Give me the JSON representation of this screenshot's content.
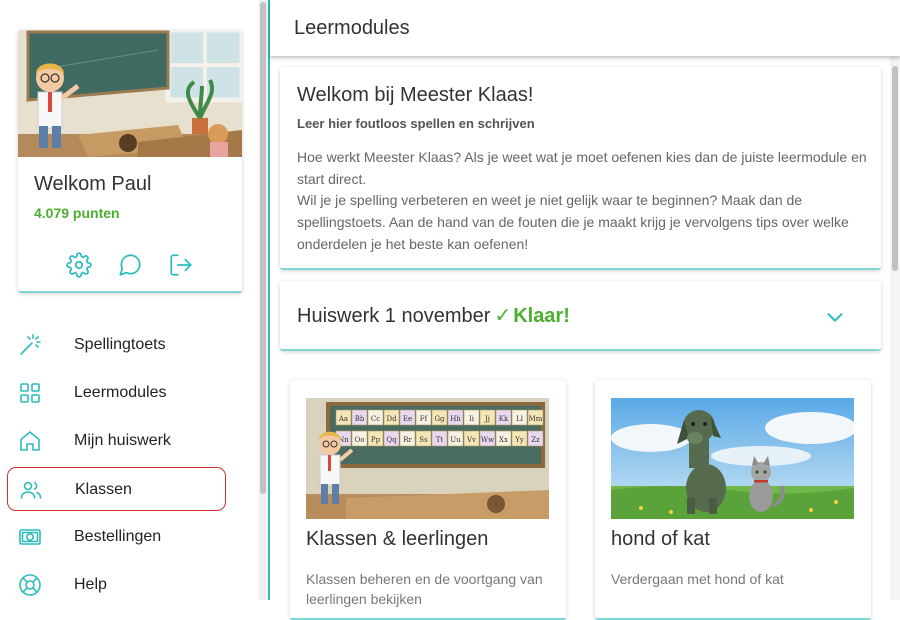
{
  "profile": {
    "greeting": "Welkom Paul",
    "points": "4.079 punten",
    "actions": [
      {
        "icon": "gear-icon"
      },
      {
        "icon": "chat-icon"
      },
      {
        "icon": "logout-icon"
      }
    ]
  },
  "nav": {
    "items": [
      {
        "label": "Spellingtoets",
        "icon": "magic-wand-icon",
        "active": false
      },
      {
        "label": "Leermodules",
        "icon": "grid-icon",
        "active": false
      },
      {
        "label": "Mijn huiswerk",
        "icon": "home-icon",
        "active": false
      },
      {
        "label": "Klassen",
        "icon": "users-icon",
        "active": true
      },
      {
        "label": "Bestellingen",
        "icon": "banknote-icon",
        "active": false
      },
      {
        "label": "Help",
        "icon": "lifebuoy-icon",
        "active": false
      }
    ]
  },
  "header": {
    "title": "Leermodules"
  },
  "welcome": {
    "title": "Welkom bij Meester Klaas!",
    "subtitle": "Leer hier foutloos spellen en schrijven",
    "paragraph1": "Hoe werkt Meester Klaas? Als je weet wat je moet oefenen kies dan de juiste leermodule en start direct.",
    "paragraph2": "Wil je je spelling verbeteren en weet je niet gelijk waar te beginnen? Maak dan de spellingstoets. Aan de hand van de fouten die je maakt krijg je vervolgens tips over welke onderdelen je het beste kan oefenen!"
  },
  "homework": {
    "title": "Huiswerk 1 november",
    "check": "✓",
    "status": "Klaar!"
  },
  "modules": [
    {
      "title": "Klassen & leerlingen",
      "description": "Klassen beheren en de voortgang van leerlingen bekijken"
    },
    {
      "title": "hond of kat",
      "description": "Verdergaan met hond of kat"
    }
  ],
  "alphabet_banner": [
    "Aa",
    "Bb",
    "Cc",
    "Dd",
    "Ee",
    "Ff",
    "Gg",
    "Hh",
    "Ii",
    "Jj",
    "Kk",
    "Ll",
    "Mm",
    "Nn",
    "Oo",
    "Pp",
    "Qq",
    "Rr",
    "Ss",
    "Tt",
    "Uu",
    "Vv",
    "Ww",
    "Xx",
    "Yy",
    "Zz"
  ],
  "colors": {
    "accent": "#2cbcbc",
    "success": "#4caf2f",
    "active_border": "#d32f2f"
  }
}
